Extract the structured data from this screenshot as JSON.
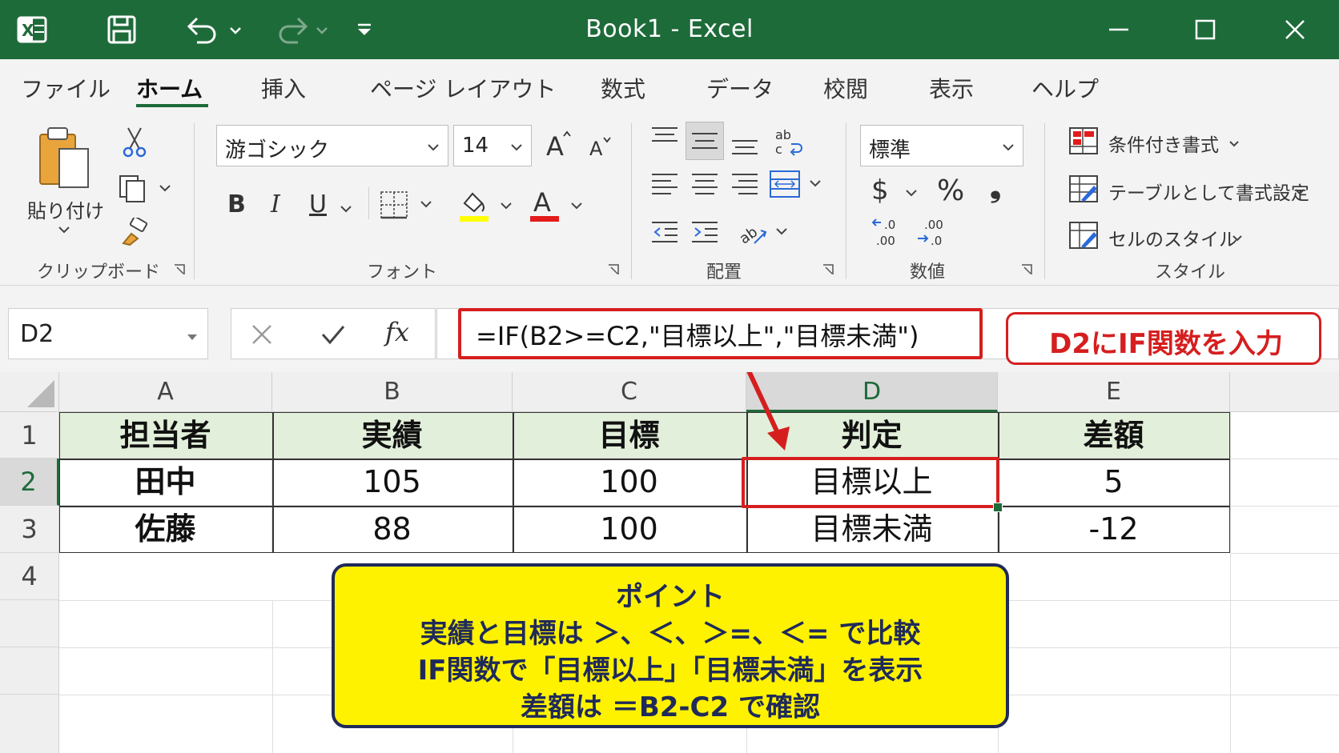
{
  "window": {
    "title": "Book1  -  Excel"
  },
  "menu": {
    "tabs": [
      "ファイル",
      "ホーム",
      "挿入",
      "ページ レイアウト",
      "数式",
      "データ",
      "校閲",
      "表示",
      "ヘルプ"
    ],
    "active_tab": "ホーム"
  },
  "ribbon": {
    "clipboard": {
      "paste_label": "貼り付け",
      "group_label": "クリップボード"
    },
    "font": {
      "font_name": "游ゴシック",
      "font_size": "14",
      "group_label": "フォント",
      "bold": "B",
      "italic": "I",
      "underline": "U",
      "font_color_glyph": "A"
    },
    "alignment": {
      "group_label": "配置"
    },
    "number": {
      "format": "標準",
      "currency": "$",
      "percent": "%",
      "comma": "❟",
      "group_label": "数値"
    },
    "styles": {
      "conditional": "条件付き書式",
      "table": "テーブルとして書式設定",
      "cell_styles": "セルのスタイル",
      "group_label": "スタイル"
    }
  },
  "formula_bar": {
    "name_box": "D2",
    "fx": "fx",
    "formula": "=IF(B2>=C2,\"目標以上\",\"目標未満\")"
  },
  "annotation": {
    "callout": "D2にIF関数を入力"
  },
  "sheet": {
    "columns": [
      "A",
      "B",
      "C",
      "D",
      "E"
    ],
    "rows": [
      "1",
      "2",
      "3",
      "4"
    ],
    "selected_cell": "D2",
    "cells": [
      [
        "担当者",
        "実績",
        "目標",
        "判定",
        "差額"
      ],
      [
        "田中",
        "105",
        "100",
        "目標以上",
        "5"
      ],
      [
        "佐藤",
        "88",
        "100",
        "目標未満",
        "-12"
      ]
    ]
  },
  "point_box": {
    "title": "ポイント",
    "lines": [
      "実績と目標は ＞、＜、＞=、＜= で比較",
      "IF関数で「目標以上」「目標未満」を表示",
      "差額は ＝B2-C2 で確認"
    ]
  },
  "colors": {
    "excel_green": "#1e6b3a",
    "highlight_red": "#d51f1f",
    "header_fill": "#e2efda",
    "note_yellow": "#fff200"
  }
}
